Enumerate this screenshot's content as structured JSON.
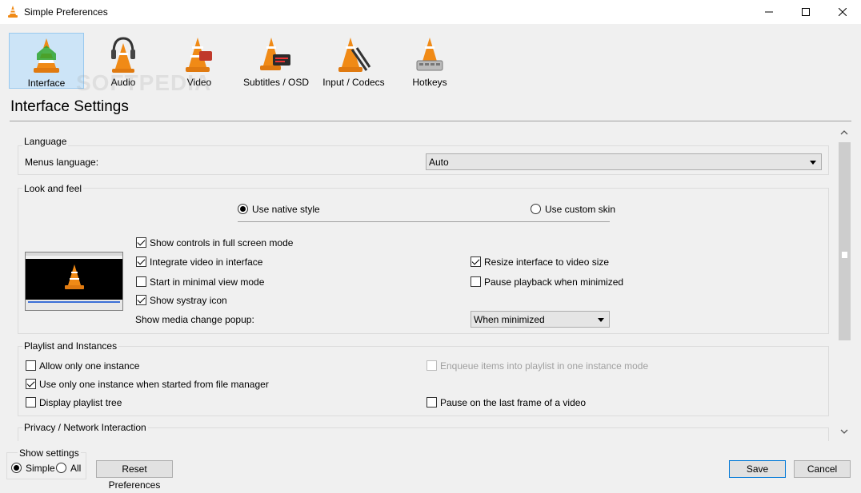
{
  "window": {
    "title": "Simple Preferences"
  },
  "categories": [
    {
      "label": "Interface",
      "icon": "interface-cone-icon"
    },
    {
      "label": "Audio",
      "icon": "audio-headphones-cone-icon"
    },
    {
      "label": "Video",
      "icon": "video-cone-icon"
    },
    {
      "label": "Subtitles / OSD",
      "icon": "subtitles-cone-icon"
    },
    {
      "label": "Input / Codecs",
      "icon": "input-codecs-cone-icon"
    },
    {
      "label": "Hotkeys",
      "icon": "hotkeys-cone-icon"
    }
  ],
  "watermark": "SOFTPEDIA",
  "page_title": "Interface Settings",
  "language": {
    "group_title": "Language",
    "menus_language_label": "Menus language:",
    "menus_language_value": "Auto"
  },
  "look": {
    "group_title": "Look and feel",
    "native_style": "Use native style",
    "custom_skin": "Use custom skin",
    "show_controls_fullscreen": "Show controls in full screen mode",
    "integrate_video": "Integrate video in interface",
    "resize_interface": "Resize interface to video size",
    "minimal_view": "Start in minimal view mode",
    "pause_minimized": "Pause playback when minimized",
    "systray": "Show systray icon",
    "popup_label": "Show media change popup:",
    "popup_value": "When minimized"
  },
  "playlist": {
    "group_title": "Playlist and Instances",
    "one_instance": "Allow only one instance",
    "enqueue": "Enqueue items into playlist in one instance mode",
    "one_instance_file_manager": "Use only one instance when started from file manager",
    "display_tree": "Display playlist tree",
    "pause_last_frame": "Pause on the last frame of a video"
  },
  "privacy": {
    "group_title": "Privacy / Network Interaction"
  },
  "show_settings": {
    "title": "Show settings",
    "simple": "Simple",
    "all": "All"
  },
  "buttons": {
    "reset": "Reset Preferences",
    "save": "Save",
    "cancel": "Cancel"
  },
  "colors": {
    "selected_bg": "#cce4f7",
    "accent": "#0078d7",
    "cone_orange": "#f08a16"
  }
}
